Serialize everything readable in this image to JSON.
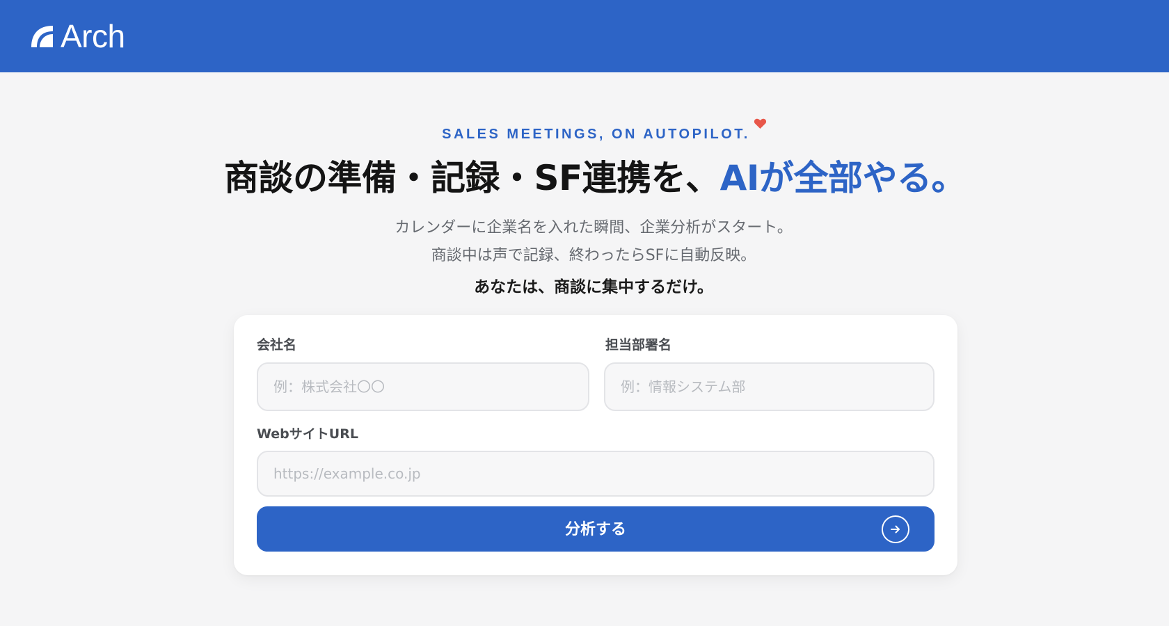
{
  "header": {
    "brand": "Arch",
    "colors": {
      "brand_blue": "#2d64c6",
      "background": "#f5f5f6"
    }
  },
  "hero": {
    "tagline": "SALES MEETINGS, ON AUTOPILOT.",
    "heart_icon": "heart-icon",
    "headline_main": "商談の準備・記録・SF連携を、",
    "headline_accent": "AIが全部やる。",
    "sub_line_1": "カレンダーに企業名を入れた瞬間、企業分析がスタート。",
    "sub_line_2": "商談中は声で記録、終わったらSFに自動反映。",
    "sub_line_3": "あなたは、商談に集中するだけ。"
  },
  "form": {
    "company": {
      "label": "会社名",
      "placeholder": "例：株式会社〇〇",
      "value": ""
    },
    "department": {
      "label": "担当部署名",
      "placeholder": "例：情報システム部",
      "value": ""
    },
    "website": {
      "label": "WebサイトURL",
      "placeholder": "https://example.co.jp",
      "value": ""
    },
    "submit_label": "分析する",
    "submit_icon": "arrow-right-icon"
  }
}
